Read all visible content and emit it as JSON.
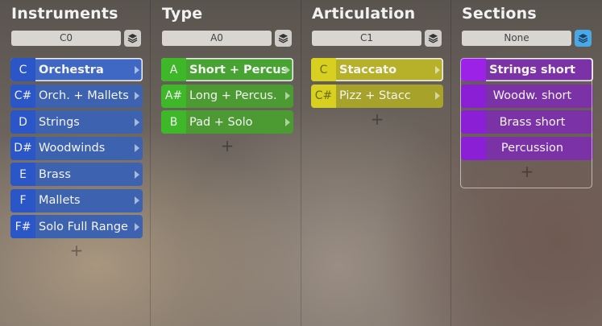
{
  "columns": [
    {
      "title": "Instruments",
      "selector": "C0",
      "items": [
        {
          "note": "C",
          "label": "Orchestra"
        },
        {
          "note": "C#",
          "label": "Orch. + Mallets"
        },
        {
          "note": "D",
          "label": "Strings"
        },
        {
          "note": "D#",
          "label": "Woodwinds"
        },
        {
          "note": "E",
          "label": "Brass"
        },
        {
          "note": "F",
          "label": "Mallets"
        },
        {
          "note": "F#",
          "label": "Solo Full Range"
        }
      ],
      "add_label": "+"
    },
    {
      "title": "Type",
      "selector": "A0",
      "items": [
        {
          "note": "A",
          "label": "Short + Percus."
        },
        {
          "note": "A#",
          "label": "Long + Percus."
        },
        {
          "note": "B",
          "label": "Pad + Solo"
        }
      ],
      "add_label": "+"
    },
    {
      "title": "Articulation",
      "selector": "C1",
      "items": [
        {
          "note": "C",
          "label": "Staccato"
        },
        {
          "note": "C#",
          "label": "Pizz + Stacc"
        }
      ],
      "add_label": "+"
    },
    {
      "title": "Sections",
      "selector": "None",
      "items": [
        {
          "note": "",
          "label": "Strings short"
        },
        {
          "note": "",
          "label": "Woodw. short"
        },
        {
          "note": "",
          "label": "Brass short"
        },
        {
          "note": "",
          "label": "Percussion"
        }
      ],
      "add_label": "+"
    }
  ],
  "icons": {
    "layer": "layers-icon",
    "arrow": "chevron-right-icon"
  },
  "colors": {
    "instruments": "#3d62b0",
    "type": "#4c9a32",
    "articulation": "#a6a22a",
    "sections": "#7a32a6",
    "layer_active": "#4aa8e6"
  }
}
